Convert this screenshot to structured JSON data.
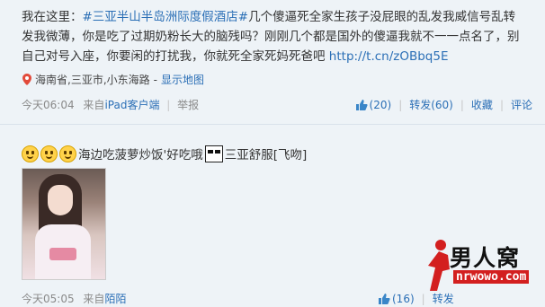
{
  "post1": {
    "prefix": "我在这里：",
    "topic": "#三亚半山半岛洲际度假酒店#",
    "text": "几个傻逼死全家生孩子没屁眼的乱发我威信号乱转发我微薄，你是吃了过期奶粉长大的脑残吗？刚刚几个都是国外的傻逼我就不一一点名了，别自己对号入座，你要闲的打扰我，你就死全家死妈死爸吧",
    "link": "http://t.cn/zOBbq5E",
    "location": "海南省,三亚市,小东海路",
    "location_sep": " - ",
    "show_map": "显示地图",
    "time": "今天06:04",
    "source_prefix": "来自",
    "source": "iPad客户端",
    "report": "举报",
    "like_count": "(20)",
    "repost": "转发(60)",
    "favorite": "收藏",
    "comment": "评论"
  },
  "post2": {
    "text_a": "海边吃菠萝炒饭'好吃哦",
    "text_b": "三亚舒服[飞吻]",
    "time": "今天05:05",
    "source_prefix": "来自",
    "source": "陌陌",
    "like_count": "(16)",
    "repost": "转发"
  },
  "watermark": {
    "name": "男人窝",
    "url": "nrwowo.com"
  },
  "colors": {
    "link": "#2b6fb6",
    "background": "#eef3f7",
    "meta": "#8a8a8a"
  }
}
